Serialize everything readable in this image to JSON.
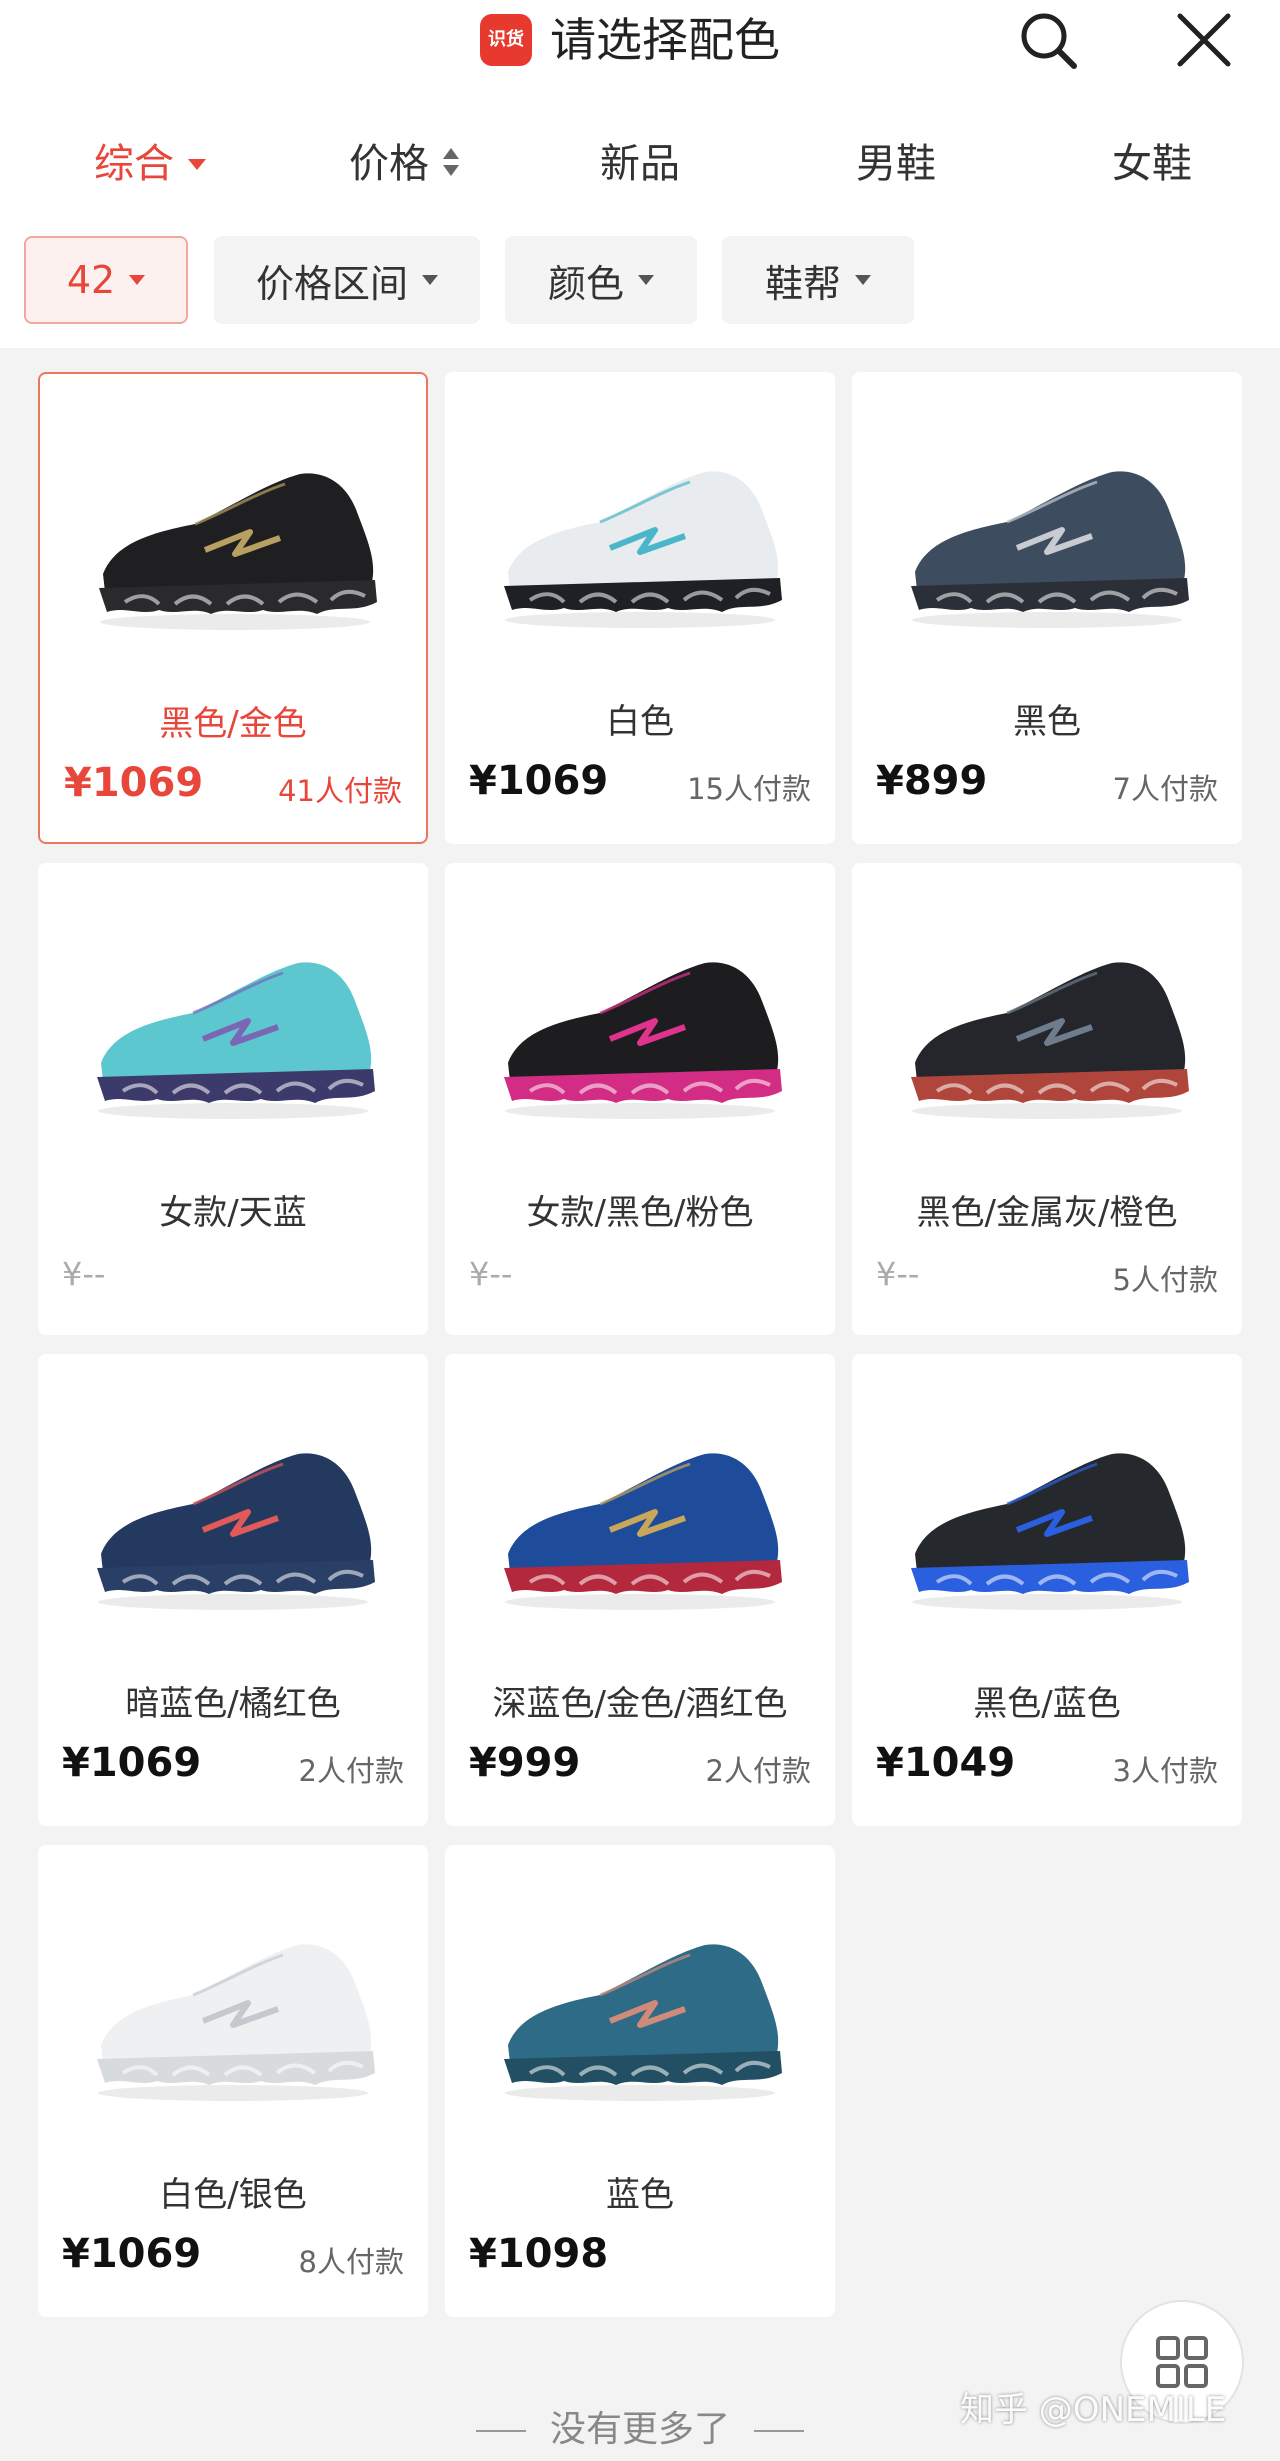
{
  "header": {
    "logo_text": "识货",
    "title": "请选择配色"
  },
  "sort_tabs": [
    {
      "label": "综合",
      "active": true
    },
    {
      "label": "价格",
      "active": false
    },
    {
      "label": "新品",
      "active": false
    },
    {
      "label": "男鞋",
      "active": false
    },
    {
      "label": "女鞋",
      "active": false
    }
  ],
  "filters": [
    {
      "label": "42",
      "active": true
    },
    {
      "label": "价格区间",
      "active": false
    },
    {
      "label": "颜色",
      "active": false
    },
    {
      "label": "鞋帮",
      "active": false
    }
  ],
  "products": [
    {
      "name": "黑色/金色",
      "price": "¥1069",
      "sales": "41人付款",
      "selected": true,
      "colors": {
        "upper": "#1f1f22",
        "accent": "#b8a062",
        "sole": "#2a2a2d"
      }
    },
    {
      "name": "白色",
      "price": "¥1069",
      "sales": "15人付款",
      "selected": false,
      "colors": {
        "upper": "#e9ecef",
        "accent": "#4bb6c9",
        "sole": "#1e2026"
      }
    },
    {
      "name": "黑色",
      "price": "¥899",
      "sales": "7人付款",
      "selected": false,
      "colors": {
        "upper": "#3e4c5f",
        "accent": "#c8ccd2",
        "sole": "#2b3038"
      }
    },
    {
      "name": "女款/天蓝",
      "price": "¥--",
      "sales": "",
      "selected": false,
      "colors": {
        "upper": "#5cc7cf",
        "accent": "#7b66b6",
        "sole": "#3c3a6a"
      }
    },
    {
      "name": "女款/黑色/粉色",
      "price": "¥--",
      "sales": "",
      "selected": false,
      "colors": {
        "upper": "#1d1d20",
        "accent": "#e0338d",
        "sole": "#d32c84"
      }
    },
    {
      "name": "黑色/金属灰/橙色",
      "price": "¥--",
      "sales": "5人付款",
      "selected": false,
      "colors": {
        "upper": "#24262b",
        "accent": "#6e7c8d",
        "sole": "#b0463b"
      }
    },
    {
      "name": "暗蓝色/橘红色",
      "price": "¥1069",
      "sales": "2人付款",
      "selected": false,
      "colors": {
        "upper": "#23395f",
        "accent": "#e05a5a",
        "sole": "#2a3f66"
      }
    },
    {
      "name": "深蓝色/金色/酒红色",
      "price": "¥999",
      "sales": "2人付款",
      "selected": false,
      "colors": {
        "upper": "#1e4b9a",
        "accent": "#c9a75a",
        "sole": "#b3283c"
      }
    },
    {
      "name": "黑色/蓝色",
      "price": "¥1049",
      "sales": "3人付款",
      "selected": false,
      "colors": {
        "upper": "#25282d",
        "accent": "#2a5fe0",
        "sole": "#2a5fe0"
      }
    },
    {
      "name": "白色/银色",
      "price": "¥1069",
      "sales": "8人付款",
      "selected": false,
      "colors": {
        "upper": "#eef0f2",
        "accent": "#c5c9ce",
        "sole": "#d8dbde"
      }
    },
    {
      "name": "蓝色",
      "price": "¥1098",
      "sales": "",
      "selected": false,
      "colors": {
        "upper": "#2e6b86",
        "accent": "#d08a7a",
        "sole": "#224f63"
      }
    }
  ],
  "footer": {
    "end_text": "没有更多了"
  },
  "watermark": "知乎 @ONEMILE"
}
